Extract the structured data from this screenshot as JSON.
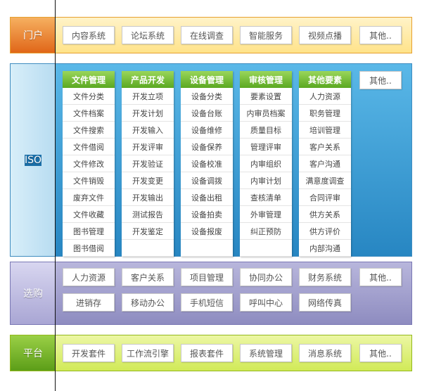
{
  "portal": {
    "label": "门户",
    "items": [
      "内容系统",
      "论坛系统",
      "在线调查",
      "智能服务",
      "视频点播",
      "其他.."
    ]
  },
  "iso": {
    "label": "ISO",
    "other": "其他..",
    "columns": [
      {
        "title": "文件管理",
        "items": [
          "文件分类",
          "文件档案",
          "文件搜索",
          "文件借阅",
          "文件修改",
          "文件销毁",
          "废弃文件",
          "文件收藏",
          "图书管理",
          "图书借阅"
        ]
      },
      {
        "title": "产品开发",
        "items": [
          "开发立项",
          "开发计划",
          "开发输入",
          "开发评审",
          "开发验证",
          "开发变更",
          "开发输出",
          "测试报告",
          "开发鉴定",
          ""
        ]
      },
      {
        "title": "设备管理",
        "items": [
          "设备分类",
          "设备台账",
          "设备维修",
          "设备保养",
          "设备校准",
          "设备调拨",
          "设备出租",
          "设备拍卖",
          "设备报废",
          ""
        ]
      },
      {
        "title": "审核管理",
        "items": [
          "要素设置",
          "内审员档案",
          "质量目标",
          "管理评审",
          "内审组织",
          "内审计划",
          "查核清单",
          "外审管理",
          "纠正预防",
          ""
        ]
      },
      {
        "title": "其他要素",
        "items": [
          "人力资源",
          "职务管理",
          "培训管理",
          "客户关系",
          "客户沟通",
          "满意度调查",
          "合同评审",
          "供方关系",
          "供方评价",
          "内部沟通"
        ]
      }
    ]
  },
  "purchase": {
    "label": "选购",
    "row1": [
      "人力资源",
      "客户关系",
      "项目管理",
      "协同办公",
      "财务系统",
      "其他.."
    ],
    "row2": [
      "进销存",
      "移动办公",
      "手机短信",
      "呼叫中心",
      "网络传真"
    ]
  },
  "platform": {
    "label": "平台",
    "items": [
      "开发套件",
      "工作流引擎",
      "报表套件",
      "系统管理",
      "消息系统",
      "其他.."
    ]
  }
}
